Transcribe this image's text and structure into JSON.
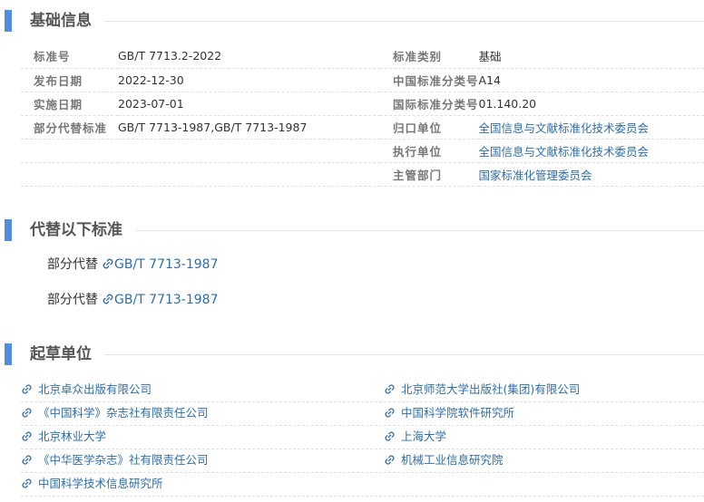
{
  "sections": {
    "basic_info": "基础信息",
    "replaces": "代替以下标准",
    "drafters": "起草单位"
  },
  "info_rows": [
    {
      "left_label": "标准号",
      "left_value": "GB/T 7713.2-2022",
      "right_label": "标准类别",
      "right_value": "基础"
    },
    {
      "left_label": "发布日期",
      "left_value": "2022-12-30",
      "right_label": "中国标准分类号",
      "right_value": "A14"
    },
    {
      "left_label": "实施日期",
      "left_value": "2023-07-01",
      "right_label": "国际标准分类号",
      "right_value": "01.140.20"
    },
    {
      "left_label": "部分代替标准",
      "left_value": "GB/T 7713-1987,GB/T 7713-1987",
      "right_label": "归口单位",
      "right_value": "全国信息与文献标准化技术委员会"
    },
    {
      "left_label": "",
      "left_value": "",
      "right_label": "执行单位",
      "right_value": "全国信息与文献标准化技术委员会"
    },
    {
      "left_label": "",
      "left_value": "",
      "right_label": "主管部门",
      "right_value": "国家标准化管理委员会"
    }
  ],
  "replaces": [
    {
      "relation": "部分代替",
      "standard": "GB/T 7713-1987"
    },
    {
      "relation": "部分代替",
      "standard": "GB/T 7713-1987"
    }
  ],
  "drafters": [
    "北京卓众出版有限公司",
    "北京师范大学出版社(集团)有限公司",
    "《中国科学》杂志社有限责任公司",
    "中国科学院软件研究所",
    "北京林业大学",
    "上海大学",
    "《中华医学杂志》社有限责任公司",
    "机械工业信息研究院",
    "中国科学技术信息研究所"
  ],
  "colors": {
    "accent": "#4f8edc",
    "link": "#2f6ea8"
  },
  "icons": {
    "link": "link-icon"
  }
}
